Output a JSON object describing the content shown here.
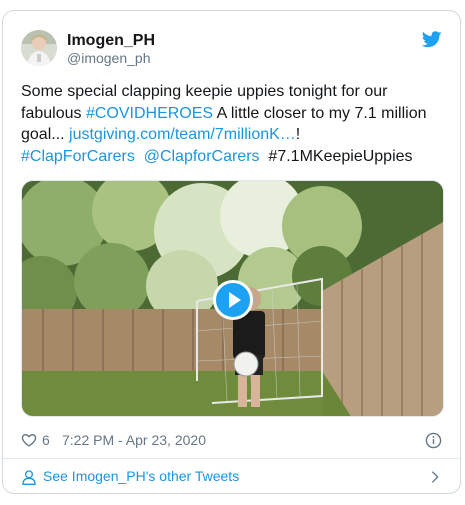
{
  "tweet": {
    "display_name": "Imogen_PH",
    "handle": "@imogen_ph",
    "text": {
      "part1": "Some special clapping keepie uppies tonight for our fabulous ",
      "hashtag_covid": "#COVIDHEROES",
      "part2": "  A little closer to my 7.1 million goal... ",
      "link": "justgiving.com/team/7millionK…",
      "part3": "!",
      "hashtag_clap": "#ClapForCarers",
      "mention": "@ClapforCarers",
      "hashtag_keepie": "#7.1MKeepieUppies"
    },
    "likes": "6",
    "timestamp": "7:22 PM - Apr 23, 2020",
    "footer_label": "See Imogen_PH's other Tweets"
  },
  "colors": {
    "accent": "#1da1f2",
    "link": "#1b95e0",
    "muted": "#657786",
    "text": "#14171a"
  },
  "icons": {
    "brand": "twitter-bird-icon",
    "like": "heart-icon",
    "info": "info-icon",
    "profile": "person-icon",
    "more": "chevron-right-icon",
    "media": "play-icon"
  }
}
